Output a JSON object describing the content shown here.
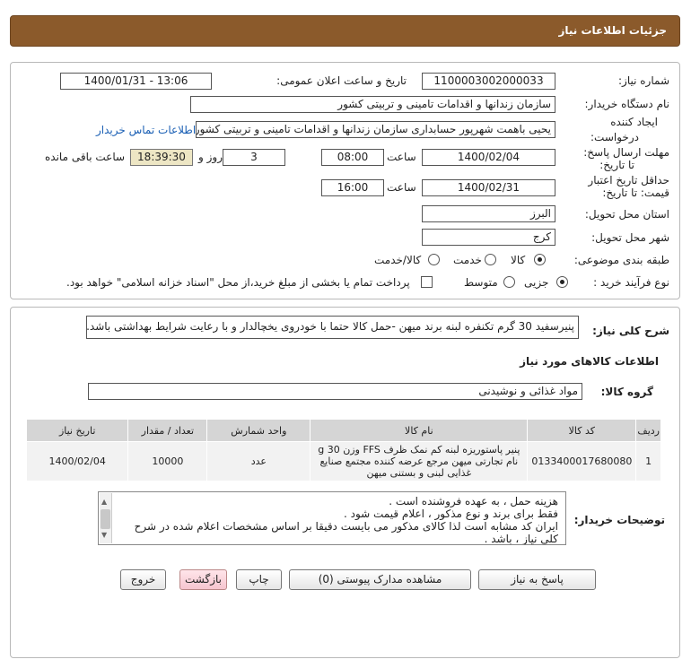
{
  "header": {
    "title": "جزئیات اطلاعات نیاز"
  },
  "form": {
    "need_number_label": "شماره نیاز:",
    "need_number": "1100003002000033",
    "announce_label": "تاریخ و ساعت اعلان عمومی:",
    "announce_value": "1400/01/31 - 13:06",
    "buyer_org_label": "نام دستگاه خریدار:",
    "buyer_org": "سازمان زندانها و اقدامات تامینی و تربیتی کشور",
    "requester_label_1": "ایجاد کننده",
    "requester_label_2": "درخواست:",
    "requester": "یحیی باهمت شهرپور حسابداری سازمان زندانها و اقدامات تامینی و تربیتی کشور",
    "contact_link": "اطلاعات تماس خریدار",
    "reply_label_1": "مهلت ارسال پاسخ:",
    "reply_label_2": "تا تاریخ:",
    "reply_date": "1400/02/04",
    "time_label": "ساعت",
    "reply_time": "08:00",
    "days_value": "3",
    "days_label": "روز و",
    "remaining_time": "18:39:30",
    "remaining_label": "ساعت باقی مانده",
    "validity_label_1": "حداقل تاریخ اعتبار",
    "validity_label_2": "قیمت: تا تاریخ:",
    "validity_date": "1400/02/31",
    "validity_time": "16:00",
    "province_label": "استان محل تحویل:",
    "province": "البرز",
    "city_label": "شهر محل تحویل:",
    "city": "کرج",
    "category_label": "طبقه بندی موضوعی:",
    "category_options": [
      "کالا",
      "خدمت",
      "کالا/خدمت"
    ],
    "category_selected": "کالا",
    "process_label": "نوع فرآیند خرید :",
    "process_options": [
      "جزیی",
      "متوسط"
    ],
    "process_selected": "جزیی",
    "payment_note": "پرداخت تمام یا بخشی از مبلغ خرید،از محل \"اسناد خزانه اسلامی\" خواهد بود."
  },
  "description": {
    "label": "شرح کلی نیاز:",
    "text": "پنیرسفید 30 گرم تکنفره لبنه برند میهن -حمل کالا حتما با خودروی یخچالدار و با رعایت شرایط بهداشتی باشد."
  },
  "goods": {
    "section_title": "اطلاعات کالاهای مورد نیاز",
    "group_label": "گروه کالا:",
    "group_value": "مواد غذائی و نوشیدنی",
    "columns": [
      "ردیف",
      "کد کالا",
      "نام کالا",
      "واحد شمارش",
      "تعداد / مقدار",
      "تاریخ نیاز"
    ],
    "rows": [
      {
        "row": "1",
        "code": "0133400017680080",
        "name": "پنیر پاستوریزه لبنه کم نمک ظرف FFS وزن 30 g نام تجارتی میهن مرجع عرضه کننده مجتمع صنایع غذایی لبنی و بستنی میهن",
        "unit": "عدد",
        "qty": "10000",
        "date": "1400/02/04"
      }
    ]
  },
  "buyer_notes": {
    "label": "توضیحات خریدار:",
    "lines": [
      "هزینه حمل ، به عهده فروشنده است .",
      "فقط برای برند و نوع  مذکور ، اعلام قیمت شود .",
      "ایران کد مشابه  است لذا کالای مذکور می بایست دقیقا بر اساس مشخصات اعلام شده  در شرح کلی نیاز ، باشد ."
    ]
  },
  "buttons": {
    "reply": "پاسخ به نیاز",
    "attachments": "مشاهده مدارک پیوستی (0)",
    "print": "چاپ",
    "back": "بازگشت",
    "exit": "خروج"
  },
  "watermark": {
    "text": "ParsNamadData"
  },
  "colors": {
    "header_bg": "#8b5a2b",
    "remaining_bg": "#ede6c4",
    "link": "#1a5fb4"
  }
}
